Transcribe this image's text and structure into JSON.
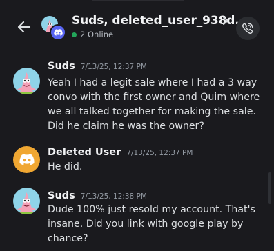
{
  "header": {
    "title": "Suds, deleted_user_938d...",
    "status": "2 Online"
  },
  "messages": [
    {
      "author": "Suds",
      "timestamp": "7/13/25, 12:37 PM",
      "text": "Yeah I had a legit sale where I had a 3 way convo with the first owner and Quim where we all talked together for making the sale. Did he claim he was the owner?",
      "avatar": "patrick-avatar"
    },
    {
      "author": "Deleted User",
      "timestamp": "7/13/25, 12:37 PM",
      "text": "He did.",
      "avatar": "discord-default-avatar"
    },
    {
      "author": "Suds",
      "timestamp": "7/13/25, 12:38 PM",
      "text": "Dude 100% just resold my account. That's insane. Did you link with google play by chance?",
      "avatar": "patrick-avatar"
    }
  ],
  "colors": {
    "background": "#1a1a1e",
    "online": "#23a55a",
    "blurple": "#5865f2",
    "deleted_avatar": "#f0a732",
    "suds_avatar": "#8fd3e8"
  }
}
